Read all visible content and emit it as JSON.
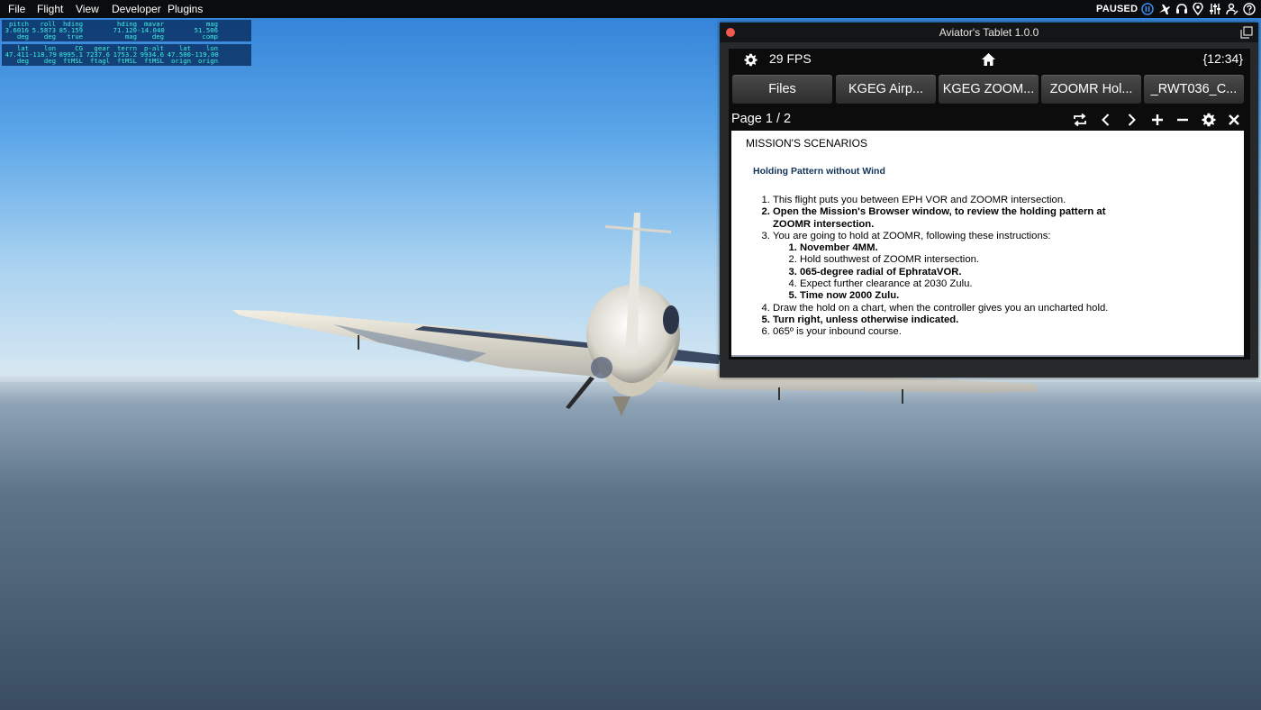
{
  "menubar": {
    "items": [
      "File",
      "Flight",
      "View",
      "Developer",
      "Plugins"
    ],
    "status": "PAUSED",
    "icons": [
      "pause-icon",
      "airplane-icon",
      "headset-icon",
      "map-pin-icon",
      "sliders-icon",
      "weight-balance-icon",
      "help-icon"
    ]
  },
  "data_output": {
    "block1": {
      "labels": [
        "pitch",
        "roll",
        "hding",
        "",
        "hding",
        "mavar",
        "",
        "mag",
        ""
      ],
      "values": [
        "3.6016",
        "5.5873",
        "85.159",
        "",
        "71.120",
        "-14.040",
        "",
        "51.506",
        ""
      ],
      "units": [
        "deg",
        "deg",
        "true",
        "",
        "mag",
        "deg",
        "",
        "comp",
        ""
      ]
    },
    "block2": {
      "labels": [
        "lat",
        "lon",
        "CG",
        "gear",
        "terrn",
        "p-alt",
        "lat",
        "lon",
        ""
      ],
      "values": [
        "47.411",
        "-118.79",
        "8995.1",
        "7237.6",
        "1753.2",
        "9934.6",
        "47.500",
        "-119.00",
        ""
      ],
      "units": [
        "deg",
        "deg",
        "ftMSL",
        "ftagl",
        "ftMSL",
        "ftMSL",
        "orign",
        "orign",
        ""
      ]
    }
  },
  "tablet": {
    "title": "Aviator's Tablet  1.0.0",
    "fps": "29 FPS",
    "clock": "{12:34}",
    "tabs": [
      "Files",
      "KGEG Airp...",
      "KGEG ZOOM...",
      "ZOOMR Hol...",
      "_RWT036_C..."
    ],
    "page_indicator": "Page 1 / 2",
    "toolbar_icons": [
      "rotate-icon",
      "prev-page-icon",
      "next-page-icon",
      "zoom-in-icon",
      "zoom-out-icon",
      "settings-icon",
      "close-icon"
    ],
    "document": {
      "title": "MISSION'S SCENARIOS",
      "subtitle": "Holding Pattern without Wind",
      "items": [
        "This flight puts you between EPH VOR and ZOOMR intersection.",
        "Open the Mission's Browser window, to review the holding pattern at ZOOMR intersection.",
        "You are going to hold at ZOOMR, following these instructions:",
        "Draw the hold on a chart, when the controller gives you an uncharted hold.",
        "Turn right, unless otherwise indicated.",
        "065º is your inbound course."
      ],
      "subitems": [
        "November 4MM.",
        "Hold southwest of ZOOMR intersection.",
        "065-degree radial of EphrataVOR.",
        "Expect further clearance at 2030 Zulu.",
        "Time now 2000 Zulu."
      ]
    }
  }
}
